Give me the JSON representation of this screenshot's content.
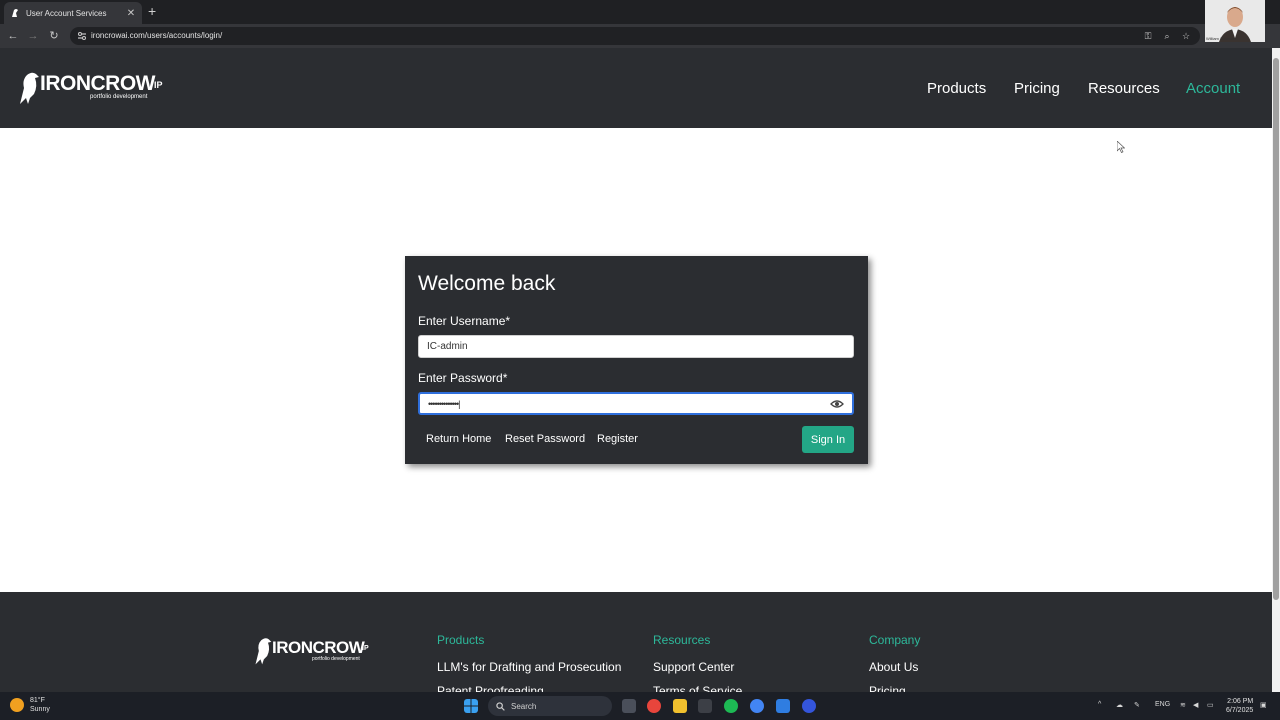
{
  "browser": {
    "tab_title": "User Account Services",
    "tab_close": "✕",
    "new_tab": "+",
    "url": "ironcrowai.com/users/accounts/login/",
    "webcam_caption": "William Scheerer"
  },
  "header": {
    "logo_text": "IRONCROW",
    "logo_suffix": "IP",
    "logo_tagline": "portfolio development",
    "nav": {
      "products": "Products",
      "pricing": "Pricing",
      "resources": "Resources",
      "account": "Account"
    }
  },
  "login": {
    "title": "Welcome back",
    "username_label": "Enter Username*",
    "username_value": "IC-admin",
    "password_label": "Enter Password*",
    "password_value": "••••••••••••••|",
    "return_home": "Return Home",
    "reset_password": "Reset Password",
    "register": "Register",
    "sign_in": "Sign In"
  },
  "footer": {
    "logo_text": "IRONCROW",
    "logo_suffix": "IP",
    "logo_tagline": "portfolio development",
    "products_heading": "Products",
    "products_links": [
      "LLM's for Drafting and Prosecution",
      "Patent Proofreading"
    ],
    "resources_heading": "Resources",
    "resources_links": [
      "Support Center",
      "Terms of Service"
    ],
    "company_heading": "Company",
    "company_links": [
      "About Us",
      "Pricing"
    ]
  },
  "taskbar": {
    "temperature": "81°F",
    "condition": "Sunny",
    "search_label": "Search",
    "language": "ENG",
    "time": "2:06 PM",
    "date": "6/7/2025"
  },
  "colors": {
    "accent": "#2db89a",
    "button": "#23a686",
    "panel": "#2b2d31"
  }
}
